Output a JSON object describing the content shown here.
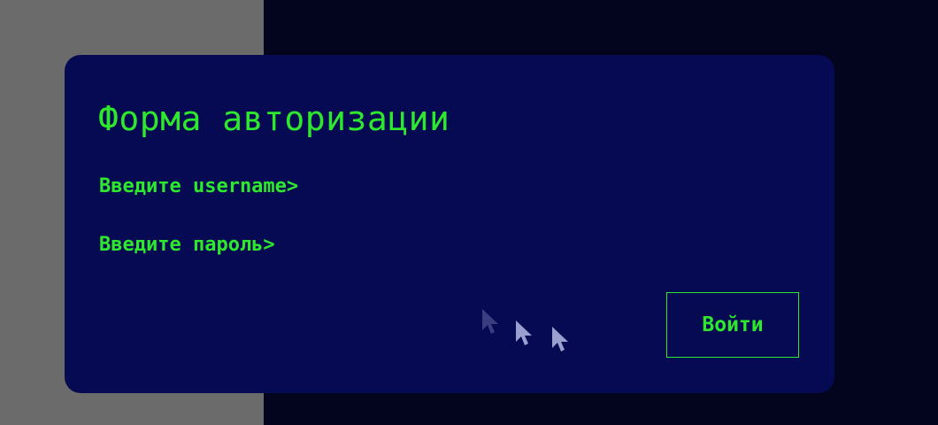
{
  "login_form": {
    "title": "Форма авторизации",
    "username_label": "Введите username>",
    "username_value": "",
    "password_label": "Введите пароль>",
    "password_value": "",
    "submit_label": "Войти"
  },
  "theme": {
    "accent_color": "#2ee82e",
    "card_background": "#060a52",
    "page_background": "#03041e",
    "side_panel_color": "#6b6b6b"
  },
  "decorations": {
    "cursor_icon": "mouse-pointer-icon",
    "cursor_count": 3
  }
}
